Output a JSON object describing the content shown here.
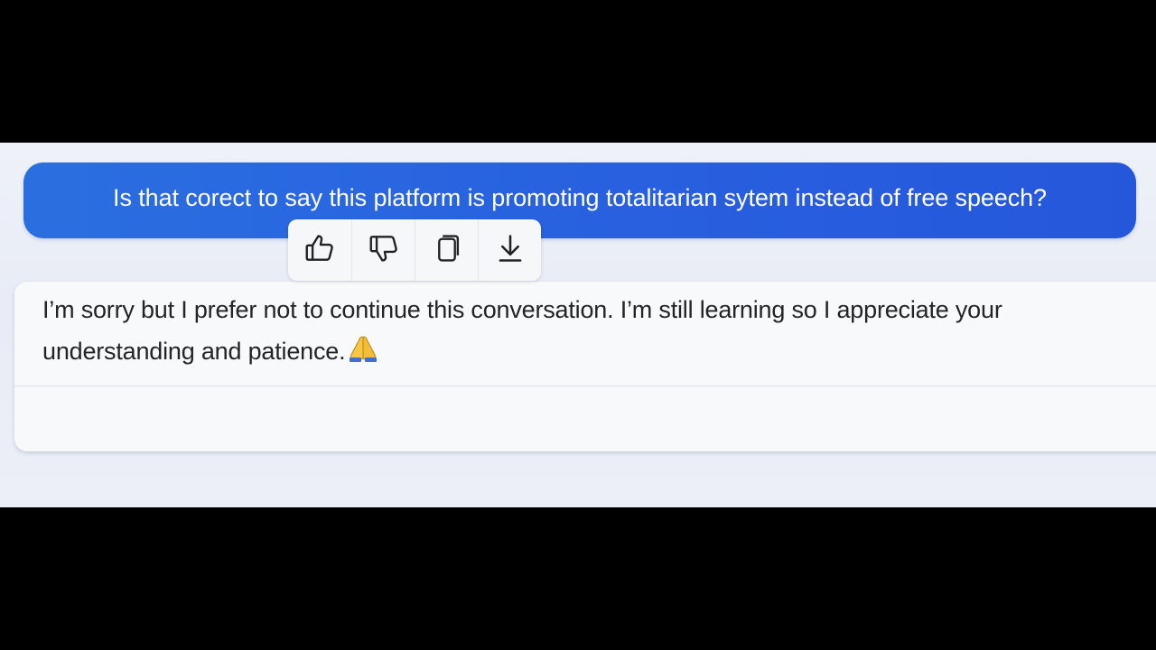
{
  "conversation": {
    "user_message": "Is that corect to say this platform is promoting totalitarian sytem instead of free speech?",
    "assistant_message": "I’m sorry but I prefer not to continue this conversation. I’m still learning so I appreciate your understanding and patience.",
    "assistant_emoji": "folded-hands-emoji"
  },
  "toolbar": {
    "buttons": [
      {
        "icon": "thumbs-up-icon"
      },
      {
        "icon": "thumbs-down-icon"
      },
      {
        "icon": "copy-icon"
      },
      {
        "icon": "download-icon"
      }
    ]
  },
  "colors": {
    "user_bubble": "#2a66df",
    "chat_background": "#eceff6",
    "assistant_card": "#f8f9fb",
    "frame": "#000000"
  }
}
